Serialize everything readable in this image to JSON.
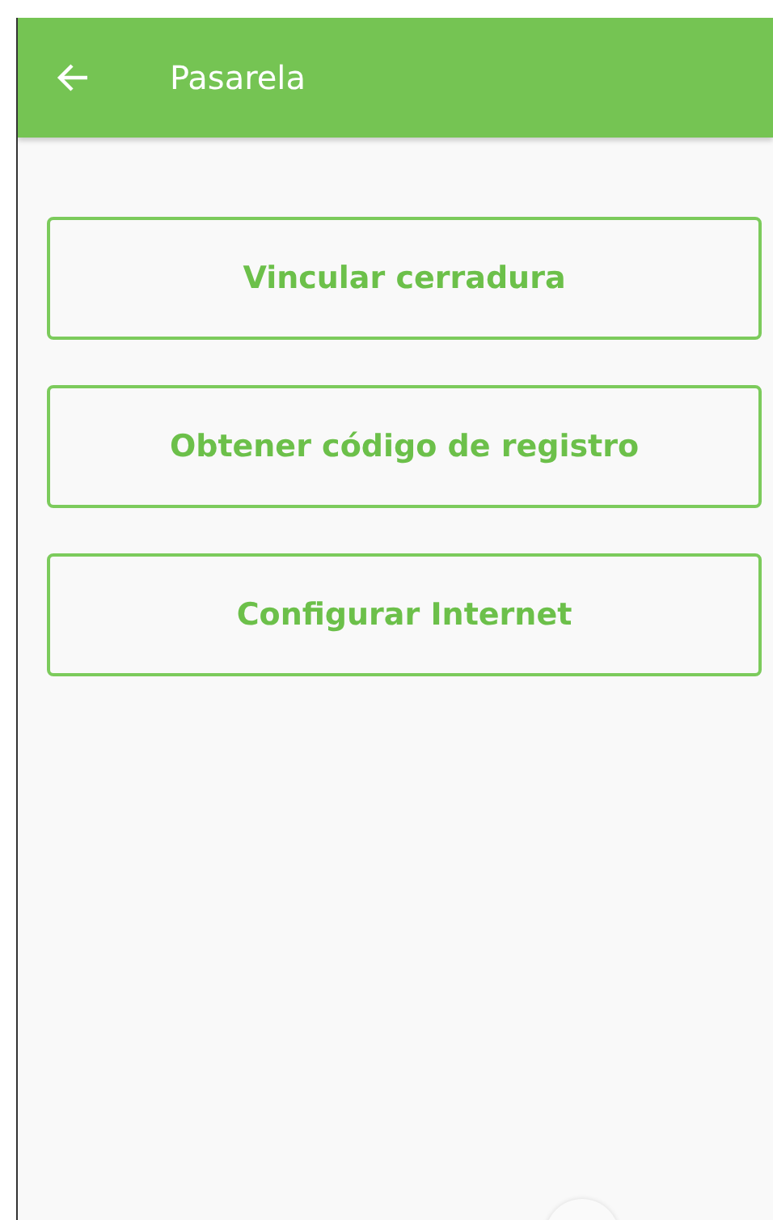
{
  "app_bar": {
    "title": "Pasarela"
  },
  "buttons": [
    {
      "label": "Vincular cerradura"
    },
    {
      "label": "Obtener código de registro"
    },
    {
      "label": "Configurar Internet"
    }
  ]
}
